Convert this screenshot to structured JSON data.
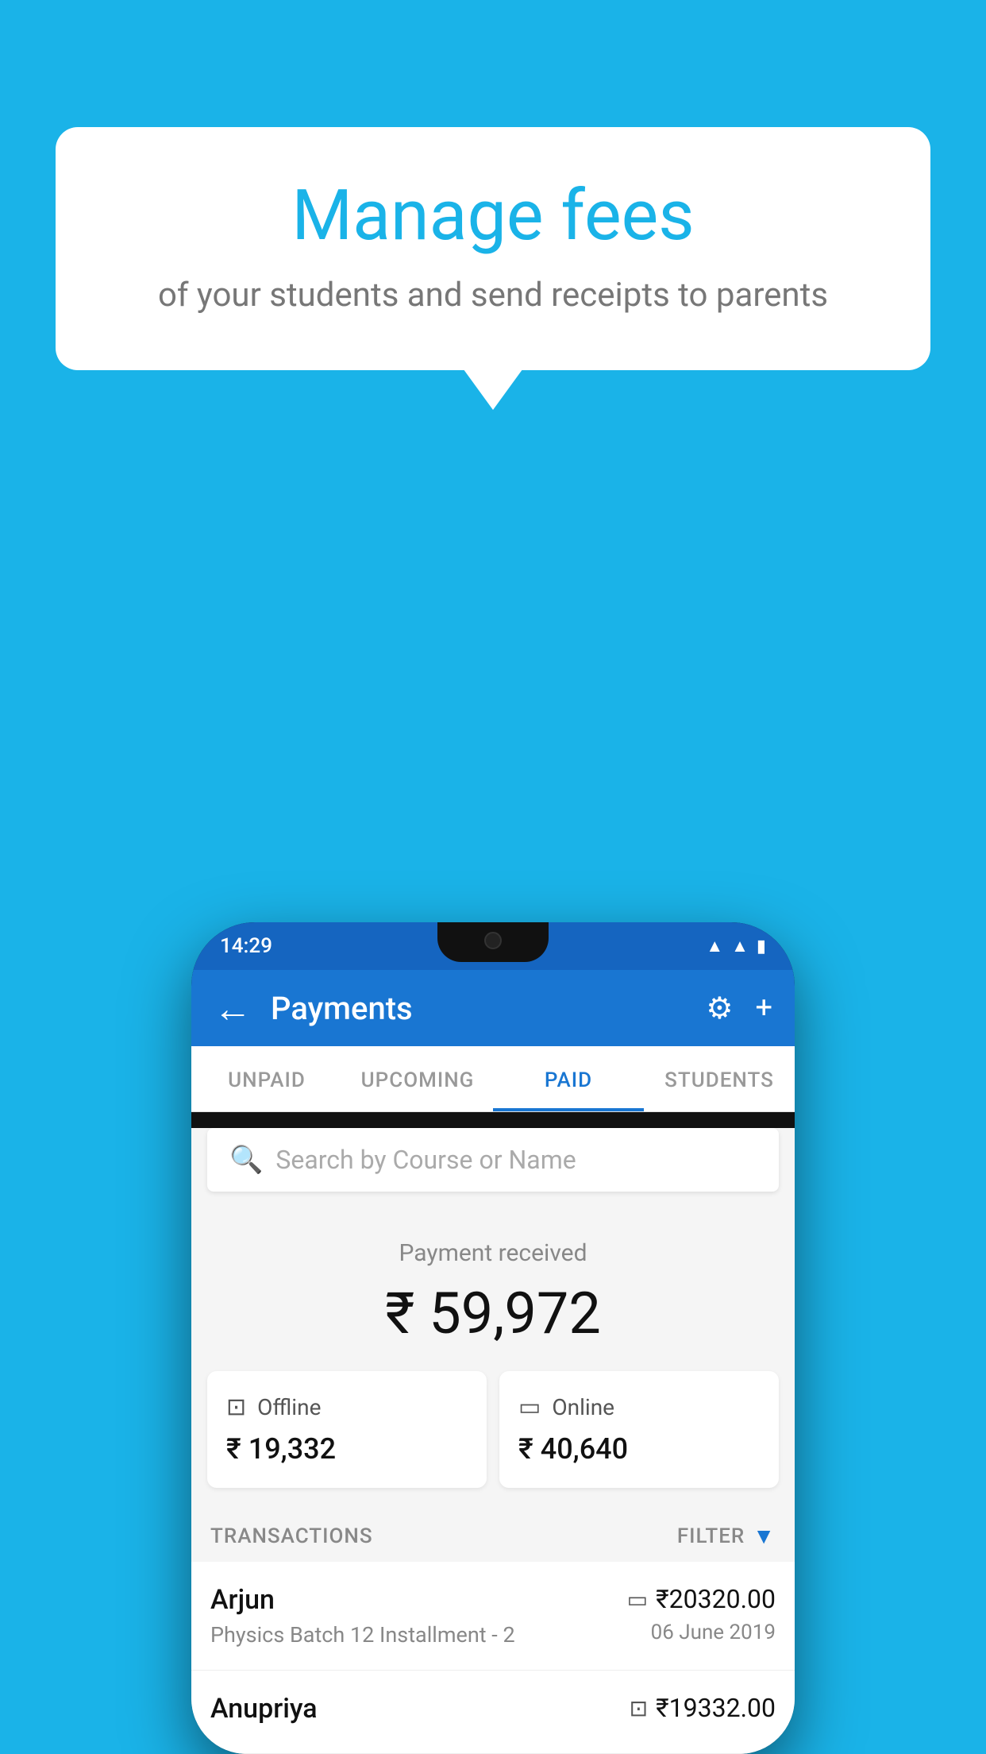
{
  "page": {
    "background_color": "#1ab3e8"
  },
  "speech_bubble": {
    "heading": "Manage fees",
    "subtext": "of your students and send receipts to parents"
  },
  "phone": {
    "status_bar": {
      "time": "14:29",
      "wifi_icon": "wifi",
      "signal_icon": "signal",
      "battery_icon": "battery"
    },
    "app_bar": {
      "title": "Payments",
      "back_icon": "←",
      "settings_icon": "⚙",
      "add_icon": "+"
    },
    "tabs": [
      {
        "label": "UNPAID",
        "active": false
      },
      {
        "label": "UPCOMING",
        "active": false
      },
      {
        "label": "PAID",
        "active": true
      },
      {
        "label": "STUDENTS",
        "active": false
      }
    ],
    "search": {
      "placeholder": "Search by Course or Name"
    },
    "payment_received": {
      "label": "Payment received",
      "amount": "₹ 59,972",
      "offline": {
        "label": "Offline",
        "amount": "₹ 19,332"
      },
      "online": {
        "label": "Online",
        "amount": "₹ 40,640"
      }
    },
    "transactions": {
      "section_label": "TRANSACTIONS",
      "filter_label": "FILTER",
      "items": [
        {
          "name": "Arjun",
          "course": "Physics Batch 12 Installment - 2",
          "amount": "₹20320.00",
          "date": "06 June 2019",
          "payment_method": "online"
        },
        {
          "name": "Anupriya",
          "course": "",
          "amount": "₹19332.00",
          "date": "",
          "payment_method": "offline"
        }
      ]
    }
  }
}
